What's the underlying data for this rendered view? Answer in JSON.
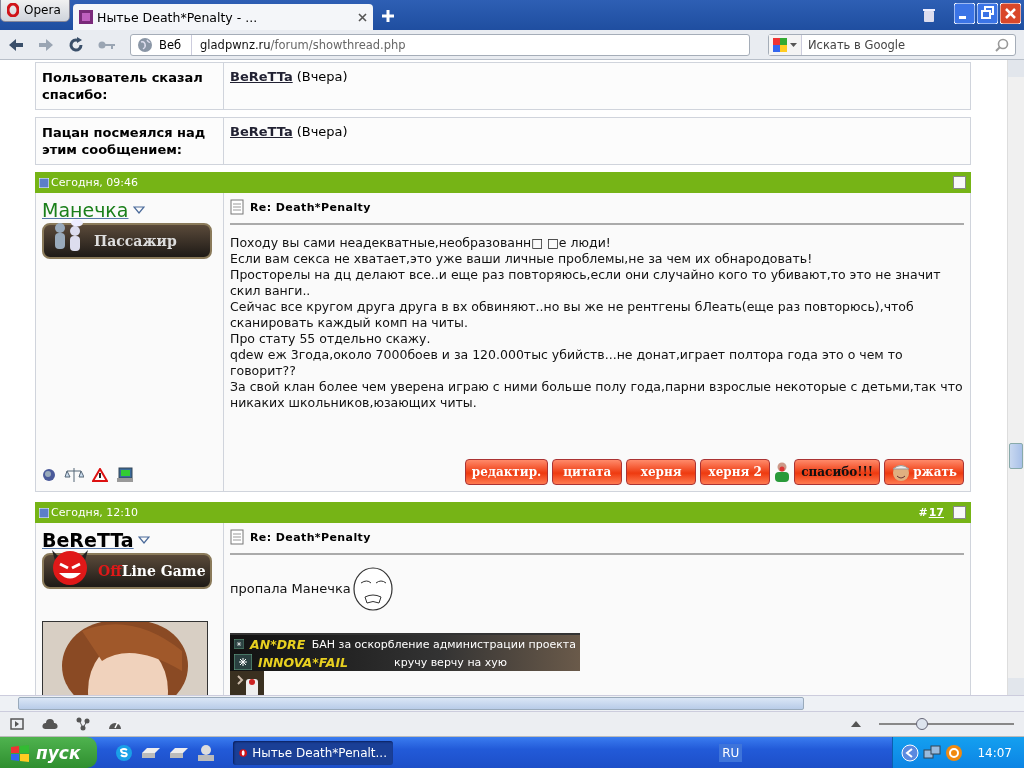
{
  "browser": {
    "menu_button": "Opera",
    "tabs": [
      {
        "title": "Нытье Death*Penalty - ...",
        "selected": true
      }
    ],
    "address": {
      "label": "Веб",
      "domain": "gladpwnz.ru",
      "path": "/forum/showthread.php"
    },
    "search": {
      "placeholder": "Искать в Google"
    }
  },
  "thanks": [
    {
      "label": "Пользователь сказал спасибо:",
      "user": "BeReTTa",
      "when": "(Вчера)"
    },
    {
      "label": "Пацан посмеялся над этим сообщением:",
      "user": "BeReTTa",
      "when": "(Вчера)"
    }
  ],
  "posts": [
    {
      "date": "Сегодня, 09:46",
      "selected": false,
      "username": "Манечка",
      "color": "#1a7f1a",
      "rank": {
        "kind": "passenger",
        "text": "Пассажир"
      },
      "title": "Re: Death*Penalty",
      "body": [
        "Походу вы сами неадекватные,необразованн□ □е люди!",
        "Если вам секса не хватает,это уже ваши личные проблемы,не за чем их обнародовать!",
        "Просторелы на дц делают все..и еще раз повторяюсь,если они случайно кого то убивают,то это не значит скил ванги..",
        "Сейчас все кругом друга друга в вх обвиняют..но вы же не рентгены бЛеать(еще раз повторюсь),чтоб сканировать каждый комп на читы.",
        "Про стату 55 отдельно скажу.",
        "qdew еж 3года,около 7000боев и за 120.000тыс убийств...не донат,играет полтора года это о чем то говорит??",
        "За свой клан более чем уверена играю с ними больше полу года,парни взрослые некоторые с детьми,так что никаких школьников,юзающих читы."
      ],
      "buttons": [
        {
          "kind": "plain",
          "label": "редактир."
        },
        {
          "kind": "plain",
          "label": "цитата"
        },
        {
          "kind": "plain",
          "label": "херня"
        },
        {
          "kind": "plain",
          "label": "херня 2"
        },
        {
          "kind": "thanks",
          "label": "спасибо!!!"
        },
        {
          "kind": "laugh",
          "label": "ржать"
        }
      ]
    },
    {
      "date": "Сегодня, 12:10",
      "number_sign": "#",
      "number": "17",
      "selected": false,
      "username": "BeReTTa",
      "color": "#000000",
      "rank": {
        "kind": "offline",
        "prefix": "Off",
        "text": "Line Game"
      },
      "avatar": {
        "kind": "picture"
      },
      "title": "Re: Death*Penalty",
      "body": [
        "пропала Манечка"
      ],
      "signature": [
        {
          "nick": "AN*DRE",
          "text": "БАН за оскорбление администрации проекта"
        },
        {
          "nick": "INNOVA*FAIL",
          "text": "кручу верчу на хую"
        }
      ]
    }
  ],
  "status_bar": {
    "zoom": {
      "level": 0.32
    }
  },
  "taskbar": {
    "start": "пуск",
    "tasks": [
      {
        "title": "Нытье Death*Penalt...",
        "selected": true
      }
    ],
    "language": "RU",
    "clock": "14:07"
  }
}
